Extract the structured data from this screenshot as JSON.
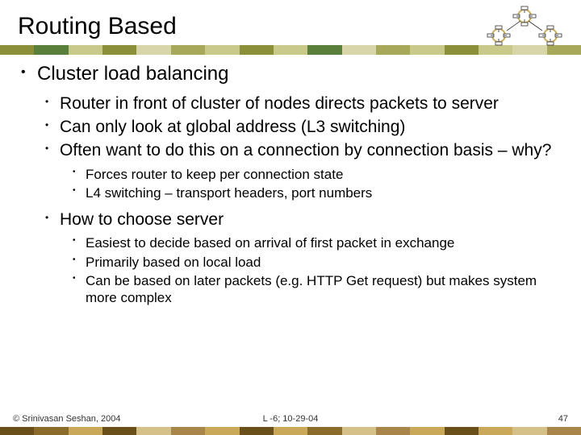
{
  "title": "Routing Based",
  "stripe_colors": [
    "#8a8f3a",
    "#5a7f3a",
    "#c9c98a",
    "#8a8f3a",
    "#d6d6a8",
    "#a8a85a",
    "#c9c98a",
    "#8a8f3a",
    "#c9c98a",
    "#5a7f3a",
    "#d6d6a8",
    "#a8a85a",
    "#c9c98a",
    "#8a8f3a",
    "#c9c98a",
    "#d6d6a8",
    "#a8a85a"
  ],
  "content": {
    "lvl1": [
      {
        "text": "Cluster load balancing",
        "lvl2": [
          {
            "text": "Router in front of cluster of nodes directs packets to server"
          },
          {
            "text": "Can only look at global address (L3 switching)"
          },
          {
            "text": "Often want to do this on a connection by connection basis – why?",
            "lvl3": [
              "Forces router to keep per connection state",
              "L4 switching – transport headers, port numbers"
            ]
          },
          {
            "text": "How to choose server",
            "lvl3": [
              "Easiest to decide based on arrival of first packet in exchange",
              "Primarily based on local load",
              "Can be based on later packets (e.g. HTTP Get request) but makes system more complex"
            ]
          }
        ]
      }
    ]
  },
  "footer": {
    "left": "© Srinivasan Seshan, 2004",
    "center": "L -6; 10-29-04",
    "right": "47"
  },
  "footer_colors": [
    "#6b4f1a",
    "#8a6b2a",
    "#c9a85a",
    "#6b4f1a",
    "#d6c08a",
    "#a8864a",
    "#c9a85a",
    "#6b4f1a",
    "#c9a85a",
    "#8a6b2a",
    "#d6c08a",
    "#a8864a",
    "#c9a85a",
    "#6b4f1a",
    "#c9a85a",
    "#d6c08a",
    "#a8864a"
  ]
}
